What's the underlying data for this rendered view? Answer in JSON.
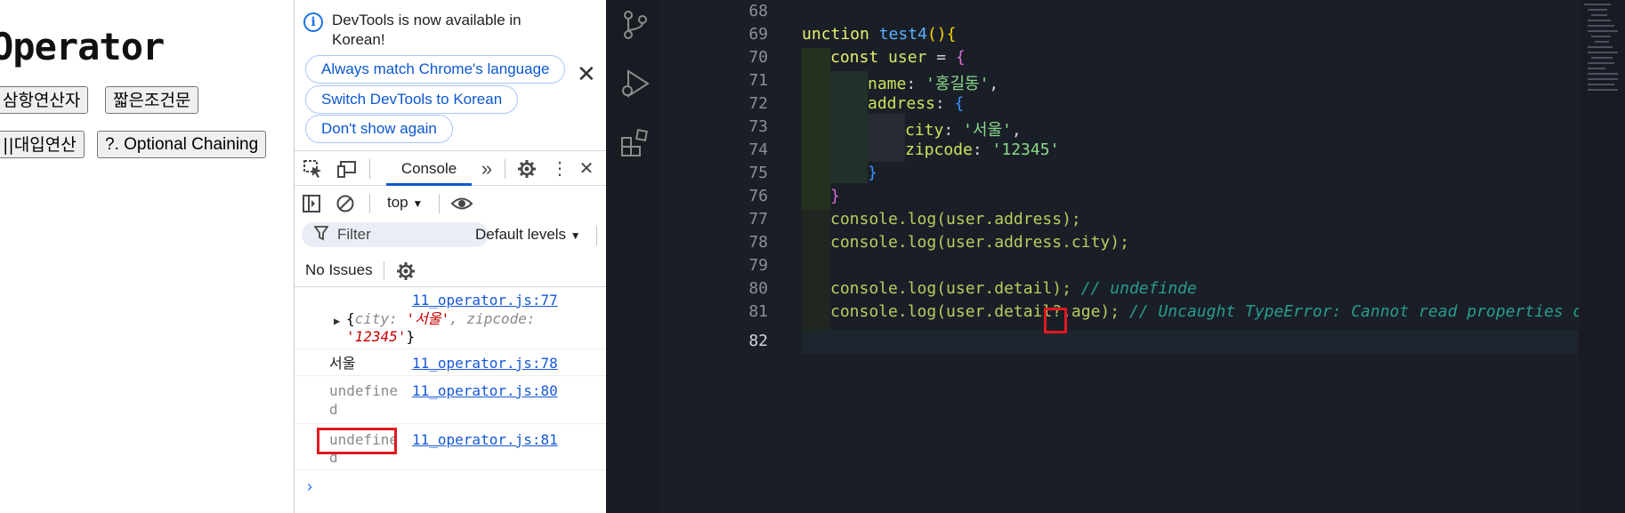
{
  "webpage": {
    "heading": "Operator",
    "buttons": [
      "삼항연산자",
      "짧은조건문",
      "||대입연산",
      "?. Optional Chaining"
    ]
  },
  "devtools": {
    "infobar": {
      "message": "DevTools is now available in Korean!",
      "buttons": [
        "Always match Chrome's language",
        "Switch DevTools to Korean",
        "Don't show again"
      ]
    },
    "tabs": {
      "active": "Console"
    },
    "toolbar": {
      "context": "top"
    },
    "filter": {
      "placeholder": "Filter",
      "levels": "Default levels"
    },
    "issues": "No Issues",
    "messages": [
      {
        "link": "11_operator.js:77",
        "obj_open": "{",
        "k1": "city",
        "v1": "'서울'",
        "k2": "zipcode",
        "v2": "'12345'",
        "obj_close": "}"
      },
      {
        "text": "서울",
        "link": "11_operator.js:78"
      },
      {
        "text1": "undefine",
        "text2": "d",
        "link": "11_operator.js:80"
      },
      {
        "text1": "undefine",
        "text2": "d",
        "link": "11_operator.js:81"
      }
    ],
    "prompt": "›"
  },
  "editor": {
    "lines": [
      {
        "num": "68"
      },
      {
        "num": "69"
      },
      {
        "num": "70"
      },
      {
        "num": "71"
      },
      {
        "num": "72"
      },
      {
        "num": "73"
      },
      {
        "num": "74"
      },
      {
        "num": "75"
      },
      {
        "num": "76"
      },
      {
        "num": "77"
      },
      {
        "num": "78"
      },
      {
        "num": "79"
      },
      {
        "num": "80"
      },
      {
        "num": "81"
      },
      {
        "num": "82"
      }
    ],
    "code": {
      "l69_kw": "unction",
      "l69_fn": "test4",
      "l70_kw": "const",
      "l70_var": "user",
      "l71_prop": "name",
      "l71_str": "'홍길동'",
      "l72_prop": "address",
      "l73_prop": "city",
      "l73_str": "'서울'",
      "l74_prop": "zipcode",
      "l74_str": "'12345'",
      "l77": "console.log(user.address);",
      "l78": "console.log(user.address.city);",
      "l80_code": "console.log(user.detail);",
      "l80_cmt": "// undefinde",
      "l81_code": "console.log(user.detail?.age);",
      "l81_cmt": "// Uncaught TypeError: Cannot read properties of undef"
    }
  }
}
